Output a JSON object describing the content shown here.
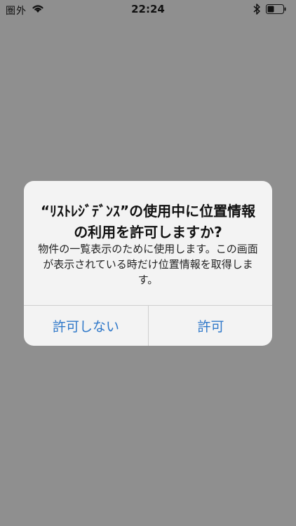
{
  "status_bar": {
    "carrier": "圏外",
    "time": "22:24",
    "icons": [
      "wifi-icon",
      "bluetooth-icon",
      "battery-icon"
    ]
  },
  "alert": {
    "title": "“ﾘｽﾄﾚｼﾞﾃﾞﾝｽ”の使用中に位置情報の利用を許可しますか?",
    "message": "物件の一覧表示のために使用します。この画面が表示されている時だけ位置情報を取得します。",
    "buttons": {
      "deny": "許可しない",
      "allow": "許可"
    }
  },
  "colors": {
    "background": "#8f8f8f",
    "alert_bg": "#f5f5f5",
    "button_text": "#2f78c9"
  }
}
